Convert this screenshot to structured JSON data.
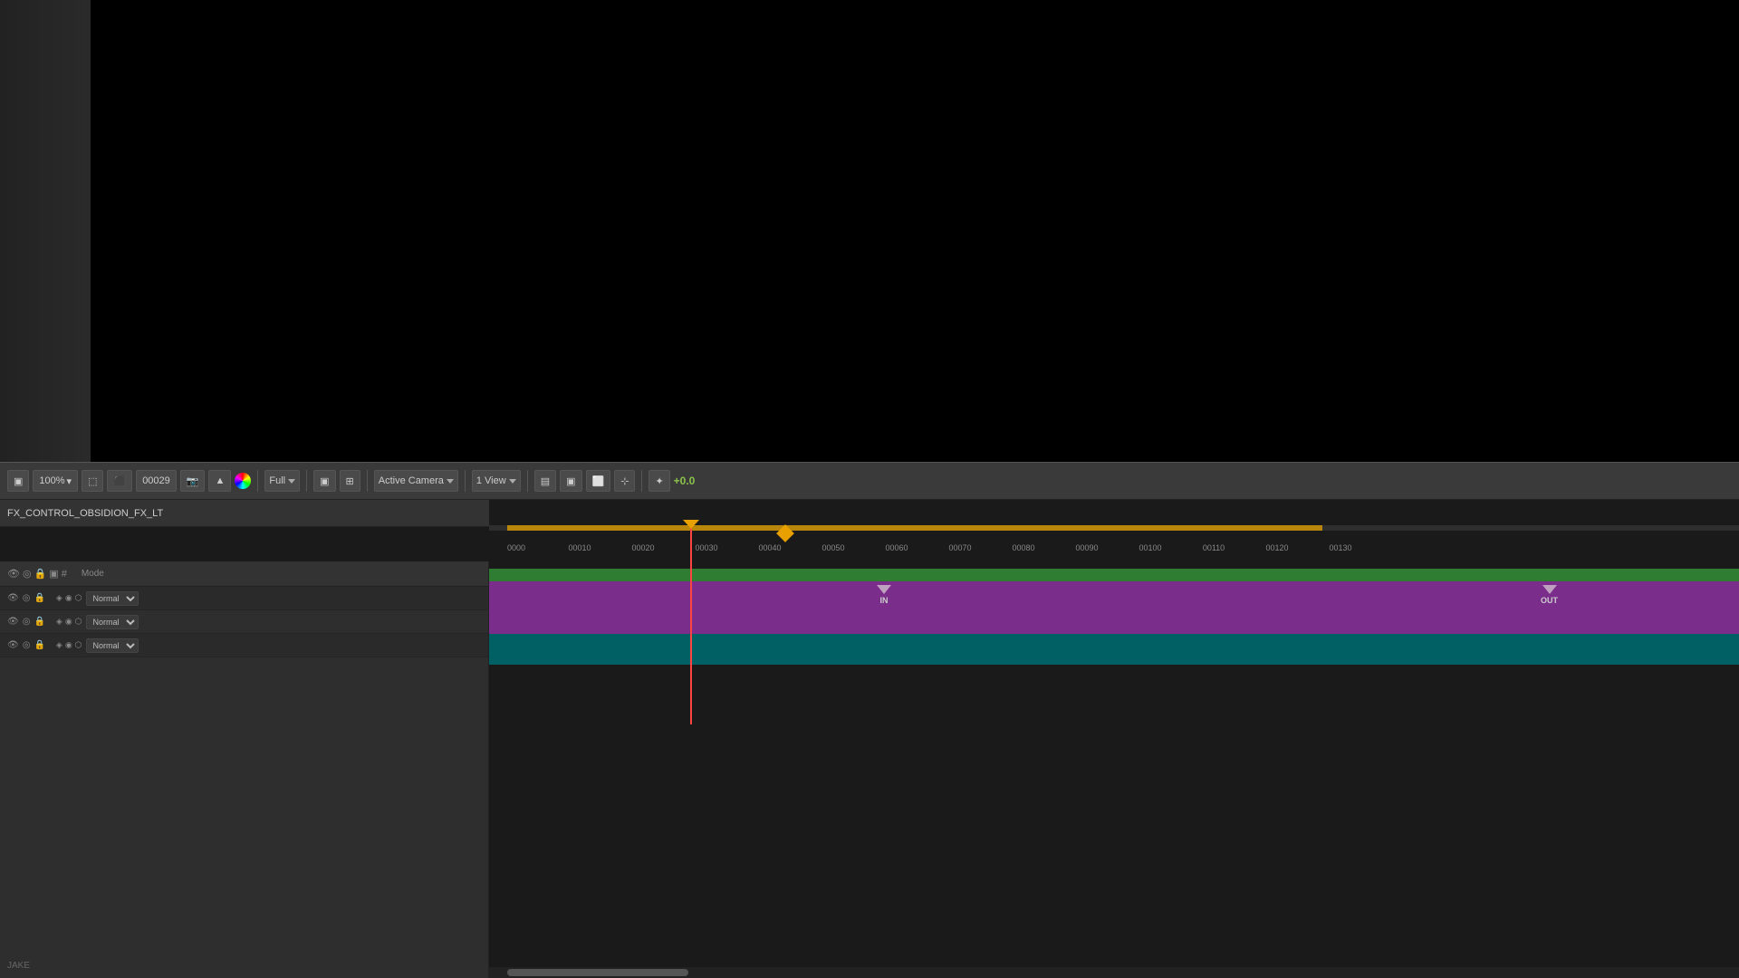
{
  "preview": {
    "bg_color": "#000000"
  },
  "toolbar": {
    "zoom_level": "100%",
    "resolution": "Full",
    "camera_label": "Active Camera",
    "view_label": "1 View",
    "time_offset": "+0.0",
    "frame_display": "00029",
    "icons": [
      "film-icon",
      "triangle-icon",
      "color-wheel-icon",
      "resolution-dropdown",
      "grid-icon",
      "camera-dropdown",
      "view-dropdown",
      "layout1-icon",
      "layout2-icon",
      "layout3-icon",
      "layout4-icon",
      "star-icon",
      "offset-value"
    ]
  },
  "composition": {
    "name": "FX_CONTROL_OBSIDION_FX_LT",
    "tab_indicator": "active"
  },
  "timeline": {
    "ruler_marks": [
      "0000",
      "00010",
      "00020",
      "00030",
      "00040",
      "00050",
      "00060",
      "00070",
      "00080",
      "00090",
      "00100",
      "00110",
      "00120",
      "00130"
    ],
    "playhead_position": "00030",
    "work_area_start": "00000",
    "work_area_end": "00130"
  },
  "layers": {
    "header_icons": [
      "eye",
      "solo",
      "lock",
      "label",
      "number",
      "source",
      "switches",
      "mode"
    ],
    "rows": [
      {
        "id": 1,
        "icons": [
          "eye",
          "solo",
          "lock"
        ],
        "name": "",
        "mode": "Normal",
        "switches": [
          "motion-blur",
          "effects",
          "3d"
        ]
      },
      {
        "id": 2,
        "icons": [
          "eye",
          "solo",
          "lock"
        ],
        "name": "",
        "mode": "Normal",
        "switches": [
          "motion-blur",
          "effects",
          "3d"
        ]
      },
      {
        "id": 3,
        "icons": [
          "eye",
          "solo",
          "lock"
        ],
        "name": "",
        "mode": "Normal",
        "switches": [
          "motion-blur",
          "effects",
          "3d"
        ]
      }
    ],
    "bottom_label": "JAKE"
  },
  "tracks": {
    "green_track": {
      "color": "#2e7d32",
      "height": 14
    },
    "purple_track": {
      "color": "#7b2d8b",
      "height": 58,
      "marker_in_label": "IN",
      "marker_out_label": "OUT"
    },
    "teal_track": {
      "color": "#006064",
      "height": 34
    }
  }
}
